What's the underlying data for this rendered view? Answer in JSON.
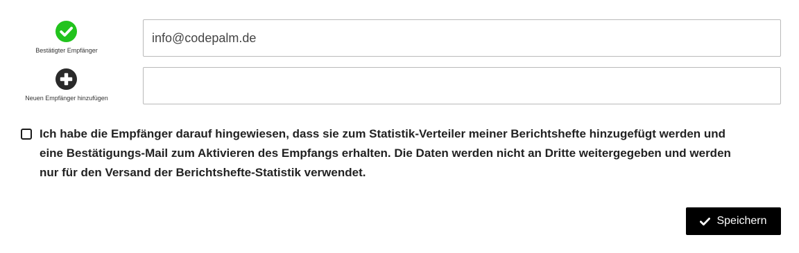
{
  "recipients": {
    "confirmed": {
      "icon": "check-circle-icon",
      "icon_color": "#22c31d",
      "label": "Bestätigter Empfänger",
      "email": "info@codepalm.de"
    },
    "add": {
      "icon": "plus-circle-icon",
      "icon_color": "#2a2a2a",
      "label": "Neuen Empfänger hinzufügen",
      "email": ""
    }
  },
  "consent": {
    "checked": false,
    "text": "Ich habe die Empfänger darauf hingewiesen, dass sie zum Statistik-Verteiler meiner Berichtshefte hinzugefügt werden und eine Bestätigungs-Mail zum Aktivieren des Empfangs erhalten. Die Daten werden nicht an Dritte weitergegeben und werden nur für den Versand der Berichtshefte-Statistik verwendet."
  },
  "actions": {
    "save_label": "Speichern",
    "save_icon": "check-icon",
    "save_bg": "#000000"
  }
}
